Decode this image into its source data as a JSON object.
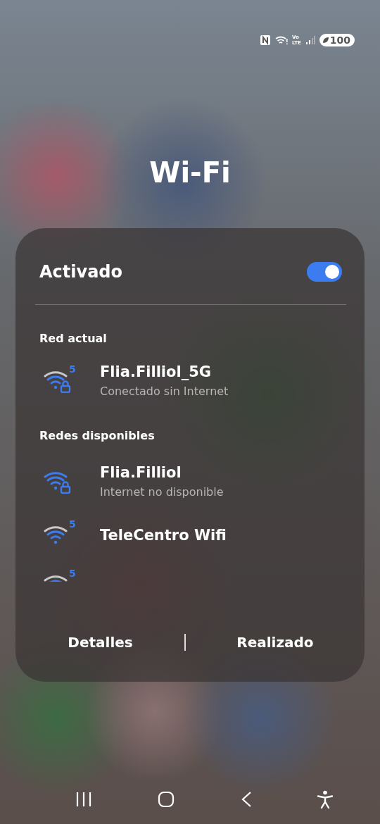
{
  "status_bar": {
    "volte": "Vo",
    "lte": "LTE",
    "battery": "100"
  },
  "title": "Wi-Fi",
  "panel": {
    "toggle_label": "Activado",
    "toggle_on": true,
    "current_heading": "Red actual",
    "current": [
      {
        "name": "Flia.Filliol_5G",
        "status": "Conectado sin Internet",
        "band": "5",
        "secured": true,
        "full_signal": false
      }
    ],
    "available_heading": "Redes disponibles",
    "available": [
      {
        "name": "Flia.Filliol",
        "status": "Internet no disponible",
        "secured": true,
        "full_signal": true
      },
      {
        "name": "TeleCentro Wifi",
        "band": "5",
        "secured": false,
        "full_signal": false
      },
      {
        "band": "5",
        "full_signal": false
      }
    ],
    "buttons": [
      "Detalles",
      "Realizado"
    ]
  }
}
